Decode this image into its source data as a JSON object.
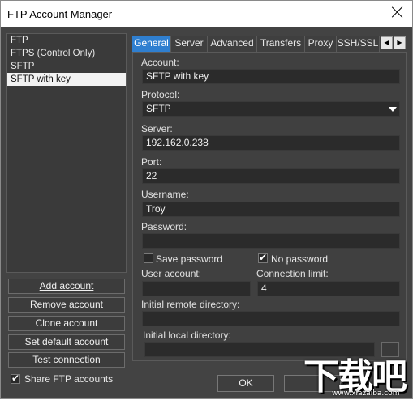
{
  "window": {
    "title": "FTP Account Manager"
  },
  "accounts": [
    {
      "label": "FTP"
    },
    {
      "label": "FTPS (Control Only)"
    },
    {
      "label": "SFTP"
    },
    {
      "label": "SFTP with key"
    }
  ],
  "selected_account": "SFTP with key",
  "left_buttons": {
    "add": "Add account",
    "remove": "Remove account",
    "clone": "Clone account",
    "set_default": "Set default account",
    "test": "Test connection"
  },
  "share": {
    "label": "Share FTP accounts",
    "checked": true
  },
  "tabs": [
    {
      "label": "General"
    },
    {
      "label": "Server"
    },
    {
      "label": "Advanced"
    },
    {
      "label": "Transfers"
    },
    {
      "label": "Proxy"
    },
    {
      "label": "SSH/SSL"
    }
  ],
  "active_tab": "General",
  "tab_scroll": {
    "left": "◀",
    "right": "▶"
  },
  "form": {
    "account_label": "Account:",
    "account_value": "SFTP with key",
    "protocol_label": "Protocol:",
    "protocol_value": "SFTP",
    "server_label": "Server:",
    "server_value": "192.162.0.238",
    "port_label": "Port:",
    "port_value": "22",
    "username_label": "Username:",
    "username_value": "Troy",
    "password_label": "Password:",
    "password_value": "",
    "save_password_label": "Save password",
    "save_password_checked": false,
    "no_password_label": "No password",
    "no_password_checked": true,
    "user_account_label": "User account:",
    "user_account_value": "",
    "connection_limit_label": "Connection limit:",
    "connection_limit_value": "4",
    "remote_dir_label": "Initial remote directory:",
    "remote_dir_value": "",
    "local_dir_label": "Initial local directory:",
    "local_dir_value": ""
  },
  "footer": {
    "ok": "OK"
  },
  "watermark": {
    "text": "下载吧",
    "url": "www.xiazaiba.com"
  },
  "colors": {
    "active_tab": "#2f7fd0",
    "panel": "#404040",
    "field": "#2b2b2b"
  }
}
